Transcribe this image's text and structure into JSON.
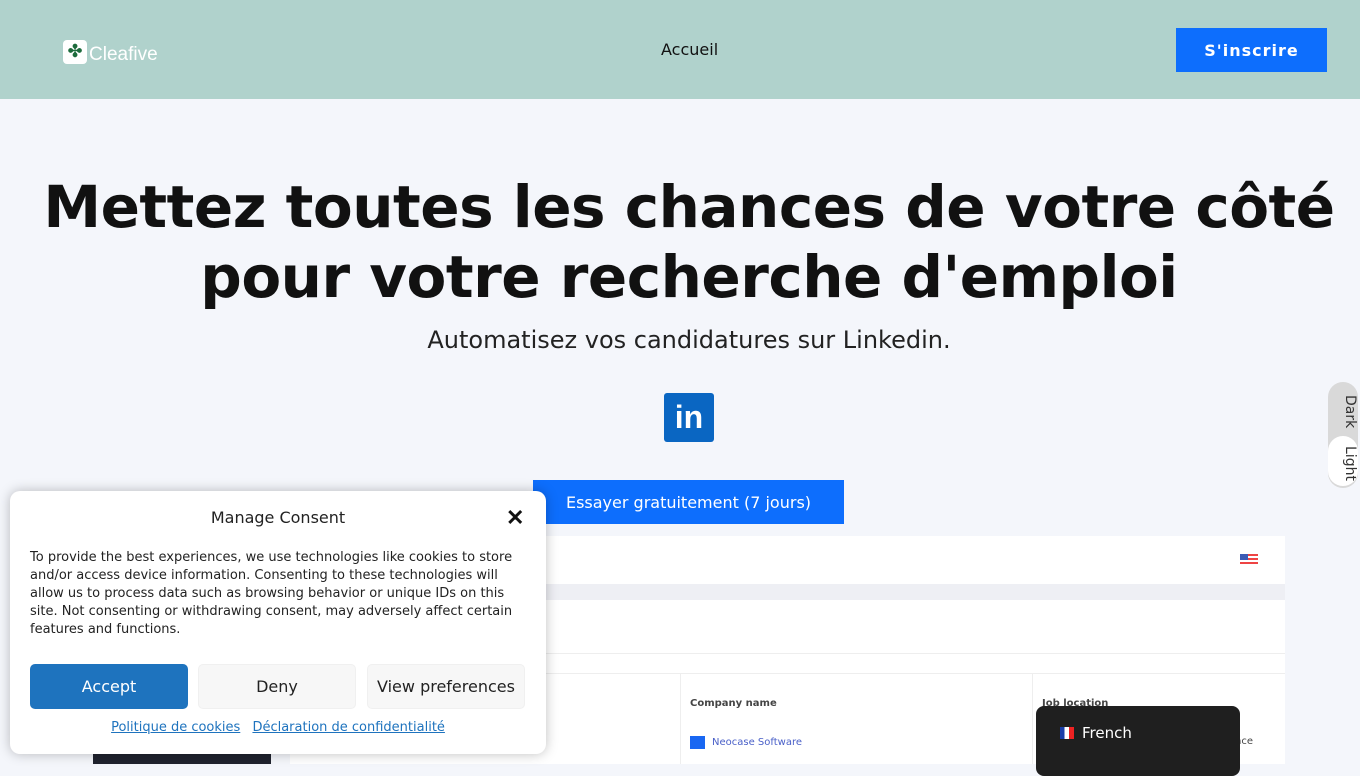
{
  "header": {
    "logo_text": "Cleafive",
    "nav_home": "Accueil",
    "signup": "S'inscrire"
  },
  "hero": {
    "title": "Mettez toutes les chances de votre côté pour votre recherche d'emploi",
    "subtitle": "Automatisez vos candidatures sur Linkedin.",
    "linkedin_icon": "in",
    "cta": "Essayer gratuitement (7 jours)"
  },
  "theme_toggle": {
    "dark": "Dark",
    "light": "Light"
  },
  "preview": {
    "col_company": "Company name",
    "col_location": "Job location",
    "company": "Neocase Software",
    "location_fragment": "nce"
  },
  "language": {
    "current": "French"
  },
  "consent": {
    "title": "Manage Consent",
    "text": "To provide the best experiences, we use technologies like cookies to store and/or access device information. Consenting to these technologies will allow us to process data such as browsing behavior or unique IDs on this site. Not consenting or withdrawing consent, may adversely affect certain features and functions.",
    "accept": "Accept",
    "deny": "Deny",
    "preferences": "View preferences",
    "cookie_policy": "Politique de cookies",
    "privacy": "Déclaration de confidentialité"
  },
  "colors": {
    "header": "#b0d2cc",
    "primary": "#0d6efd",
    "accept": "#1e73be"
  }
}
